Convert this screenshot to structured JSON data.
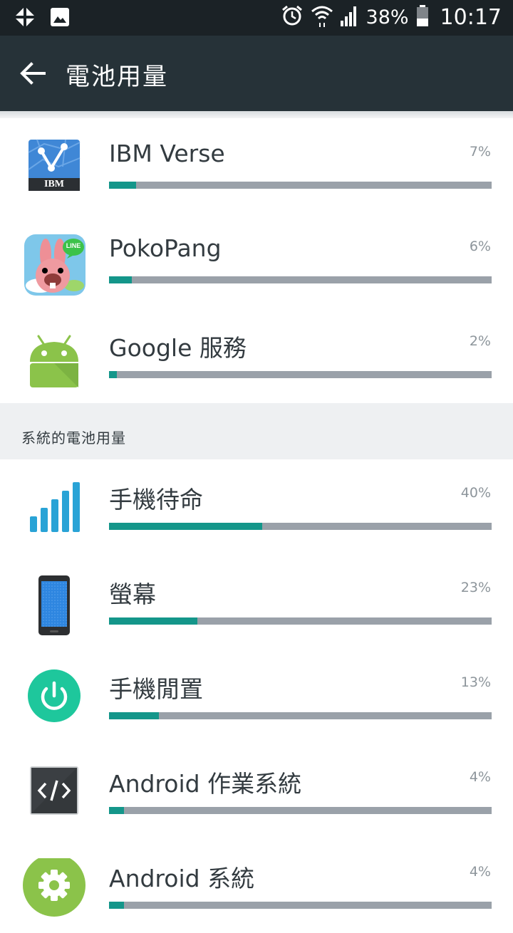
{
  "status_bar": {
    "battery_percent": "38%",
    "time": "10:17",
    "icons": [
      "pinwheel-icon",
      "image-icon",
      "alarm-icon",
      "wifi-icon",
      "signal-icon",
      "battery-icon"
    ]
  },
  "app_bar": {
    "title": "電池用量",
    "back_icon": "arrow-back-icon"
  },
  "apps": [
    {
      "label": "IBM Verse",
      "percent": "7%",
      "value": 0.07,
      "icon": "ibm-verse-icon",
      "icon_text": "IBM"
    },
    {
      "label": "PokoPang",
      "percent": "6%",
      "value": 0.06,
      "icon": "pokopang-icon",
      "icon_text": "LINE"
    },
    {
      "label": "Google 服務",
      "percent": "2%",
      "value": 0.02,
      "icon": "android-icon"
    }
  ],
  "system_section": {
    "header": "系統的電池用量",
    "items": [
      {
        "label": "手機待命",
        "percent": "40%",
        "value": 0.4,
        "icon": "signal-bars-icon"
      },
      {
        "label": "螢幕",
        "percent": "23%",
        "value": 0.23,
        "icon": "phone-screen-icon"
      },
      {
        "label": "手機閒置",
        "percent": "13%",
        "value": 0.13,
        "icon": "power-icon"
      },
      {
        "label": "Android 作業系統",
        "percent": "4%",
        "value": 0.04,
        "icon": "code-icon"
      },
      {
        "label": "Android 系統",
        "percent": "4%",
        "value": 0.04,
        "icon": "settings-gear-icon"
      }
    ]
  },
  "colors": {
    "status_bar": "#1b2226",
    "app_bar": "#263238",
    "bar_fill": "#14968a",
    "bar_track": "#9aa1a9",
    "section_bg": "#eef0f2"
  }
}
